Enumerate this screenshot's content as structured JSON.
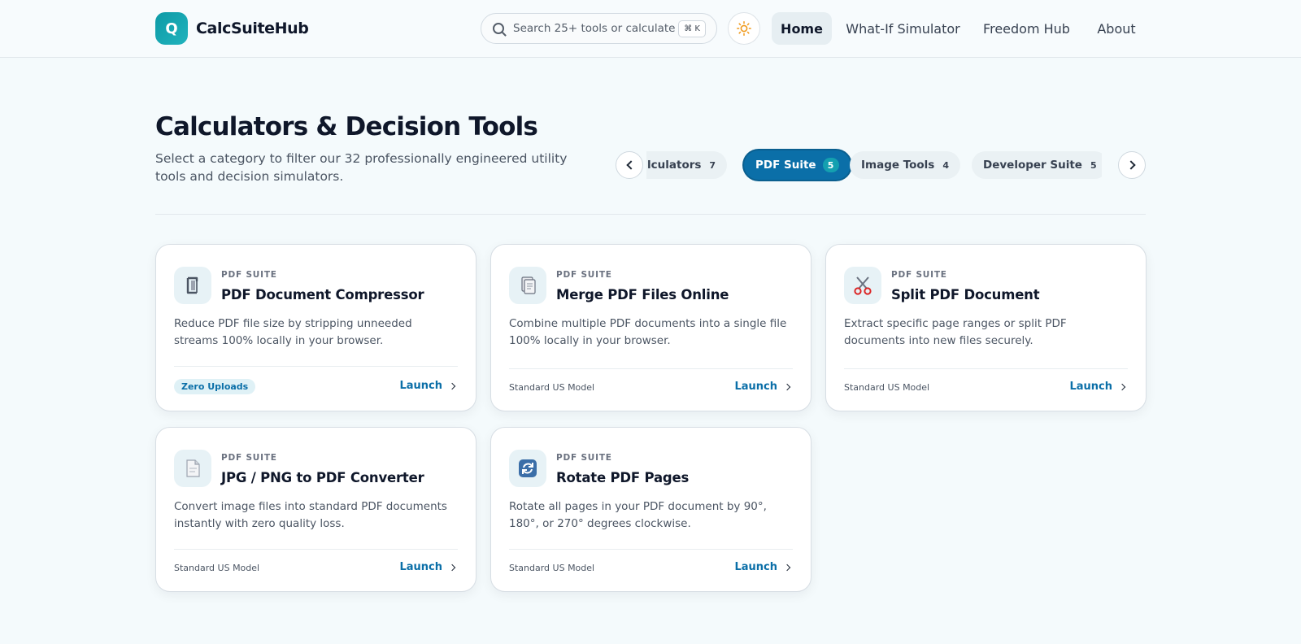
{
  "header": {
    "logo_letter": "Q",
    "brand": "CalcSuiteHub",
    "search_placeholder": "Search 25+ tools or calculate...",
    "search_shortcut": "⌘ K",
    "nav": [
      {
        "label": "Home",
        "active": true
      },
      {
        "label": "What-If Simulator",
        "active": false
      },
      {
        "label": "Freedom Hub",
        "active": false
      },
      {
        "label": "About",
        "active": false
      }
    ]
  },
  "hero": {
    "title": "Calculators & Decision Tools",
    "subtitle": "Select a category to filter our 32 professionally engineered utility tools and decision simulators."
  },
  "categories": [
    {
      "label": "Calculators",
      "count": "7",
      "active": false
    },
    {
      "label": "PDF Suite",
      "count": "5",
      "active": true
    },
    {
      "label": "Image Tools",
      "count": "4",
      "active": false
    },
    {
      "label": "Developer Suite",
      "count": "5",
      "active": false
    }
  ],
  "cards": [
    {
      "category": "PDF SUITE",
      "title": "PDF Document Compressor",
      "description": "Reduce PDF file size by stripping unneeded streams 100% locally in your browser.",
      "badge": "Zero Uploads",
      "launch": "Launch",
      "icon": "clamp-icon"
    },
    {
      "category": "PDF SUITE",
      "title": "Merge PDF Files Online",
      "description": "Combine multiple PDF documents into a single file 100% locally in your browser.",
      "meta": "Standard US Model",
      "launch": "Launch",
      "icon": "documents-icon"
    },
    {
      "category": "PDF SUITE",
      "title": "Split PDF Document",
      "description": "Extract specific page ranges or split PDF documents into new files securely.",
      "meta": "Standard US Model",
      "launch": "Launch",
      "icon": "scissors-icon"
    },
    {
      "category": "PDF SUITE",
      "title": "JPG / PNG to PDF Converter",
      "description": "Convert image files into standard PDF documents instantly with zero quality loss.",
      "meta": "Standard US Model",
      "launch": "Launch",
      "icon": "document-icon"
    },
    {
      "category": "PDF SUITE",
      "title": "Rotate PDF Pages",
      "description": "Rotate all pages in your PDF document by 90°, 180°, or 270° degrees clockwise.",
      "meta": "Standard US Model",
      "launch": "Launch",
      "icon": "refresh-icon"
    }
  ],
  "colors": {
    "accent": "#0b6fa8",
    "brand_teal": "#14a0b0",
    "background": "#f4fafc"
  }
}
